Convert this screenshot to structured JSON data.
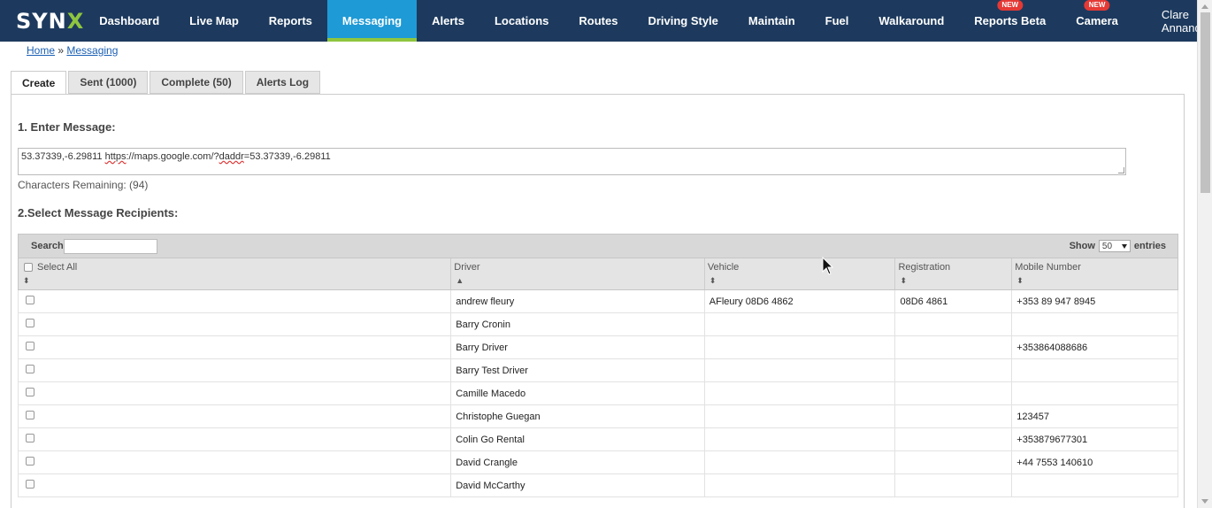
{
  "nav": {
    "logo_main": "SYN",
    "logo_x": "X",
    "items": [
      {
        "label": "Dashboard"
      },
      {
        "label": "Live Map"
      },
      {
        "label": "Reports"
      },
      {
        "label": "Messaging",
        "active": true
      },
      {
        "label": "Alerts"
      },
      {
        "label": "Locations"
      },
      {
        "label": "Routes"
      },
      {
        "label": "Driving Style"
      },
      {
        "label": "Maintain"
      },
      {
        "label": "Fuel"
      },
      {
        "label": "Walkaround"
      },
      {
        "label": "Reports Beta",
        "badge": "NEW"
      },
      {
        "label": "Camera",
        "badge": "NEW"
      }
    ],
    "user": "Clare Annand"
  },
  "breadcrumb": {
    "home": "Home",
    "sep": " » ",
    "current": "Messaging"
  },
  "tabs": [
    {
      "label": "Create",
      "active": true
    },
    {
      "label": "Sent (1000)"
    },
    {
      "label": "Complete (50)"
    },
    {
      "label": "Alerts Log"
    }
  ],
  "form": {
    "step1": "1. Enter Message:",
    "message_pre": "53.37339,-6.29811  ",
    "message_https": "https",
    "message_mid": "://maps.google.com/?",
    "message_daddr": "daddr",
    "message_post": "=53.37339,-6.29811",
    "chars_remaining": "Characters Remaining: (94)",
    "step2": "2.Select Message Recipients:"
  },
  "table": {
    "search_label": "Search:",
    "show_label": "Show",
    "show_value": "50",
    "entries_label": "entries",
    "headers": {
      "select_all": "Select All",
      "driver": "Driver",
      "vehicle": "Vehicle",
      "registration": "Registration",
      "mobile": "Mobile Number"
    },
    "rows": [
      {
        "driver": "andrew fleury",
        "vehicle": "AFleury 08D6 4862",
        "registration": "08D6 4861",
        "mobile": "+353 89 947 8945"
      },
      {
        "driver": "Barry Cronin",
        "vehicle": "",
        "registration": "",
        "mobile": ""
      },
      {
        "driver": "Barry Driver",
        "vehicle": "",
        "registration": "",
        "mobile": "+353864088686"
      },
      {
        "driver": "Barry Test Driver",
        "vehicle": "",
        "registration": "",
        "mobile": ""
      },
      {
        "driver": "Camille Macedo",
        "vehicle": "",
        "registration": "",
        "mobile": ""
      },
      {
        "driver": "Christophe Guegan",
        "vehicle": "",
        "registration": "",
        "mobile": "123457"
      },
      {
        "driver": "Colin Go Rental",
        "vehicle": "",
        "registration": "",
        "mobile": "+353879677301"
      },
      {
        "driver": "David Crangle",
        "vehicle": "",
        "registration": "",
        "mobile": "+44 7553 140610"
      },
      {
        "driver": "David McCarthy",
        "vehicle": "",
        "registration": "",
        "mobile": ""
      }
    ]
  }
}
